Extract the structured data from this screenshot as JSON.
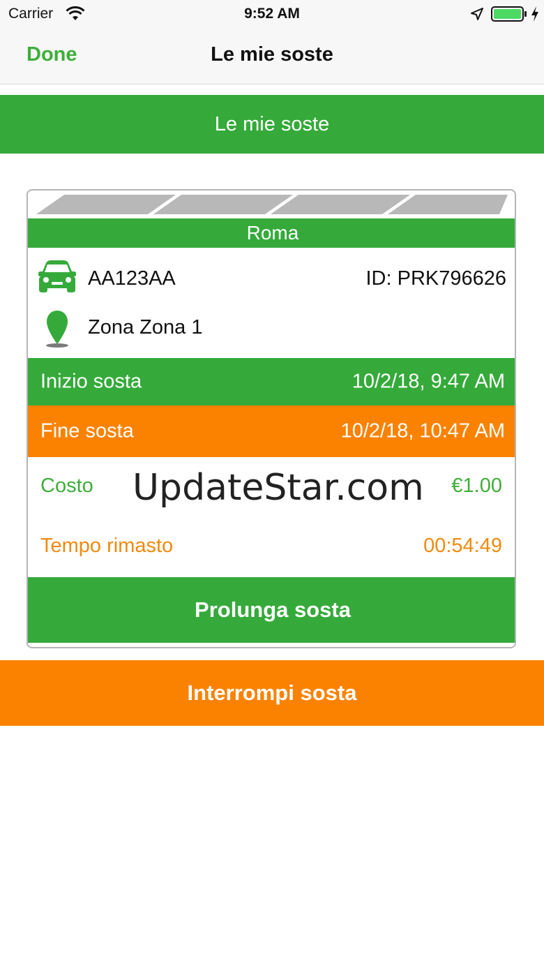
{
  "status_bar": {
    "carrier": "Carrier",
    "time": "9:52 AM",
    "icons": [
      "wifi-icon",
      "location-arrow-icon",
      "battery-icon",
      "charging-bolt-icon"
    ]
  },
  "nav": {
    "done_label": "Done",
    "title": "Le mie soste"
  },
  "section": {
    "header": "Le mie soste"
  },
  "parking": {
    "city": "Roma",
    "plate": "AA123AA",
    "id": "ID: PRK796626",
    "zone": "Zona Zona 1",
    "start_label": "Inizio sosta",
    "start_value": "10/2/18, 9:47 AM",
    "end_label": "Fine sosta",
    "end_value": "10/2/18, 10:47 AM",
    "cost_label": "Costo",
    "cost_value": "€1.00",
    "time_left_label": "Tempo rimasto",
    "time_left_value": "00:54:49",
    "extend_label": "Prolunga sosta"
  },
  "watermark": "UpdateStar.com",
  "actions": {
    "stop_label": "Interrompi sosta"
  },
  "colors": {
    "green": "#35aa3a",
    "orange": "#fb8200",
    "text_green": "#3fae3a",
    "text_orange": "#f08a10"
  }
}
